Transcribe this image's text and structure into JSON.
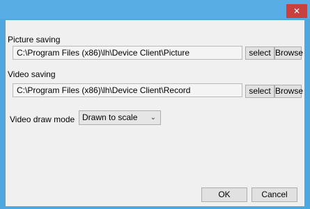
{
  "window": {
    "close_glyph": "✕"
  },
  "picture": {
    "label": "Picture saving",
    "path": "C:\\Program Files (x86)\\lh\\Device Client\\Picture",
    "select_label": "select",
    "browse_label": "Browse"
  },
  "video": {
    "label": "Video saving",
    "path": "C:\\Program Files (x86)\\lh\\Device Client\\Record",
    "select_label": "select",
    "browse_label": "Browse"
  },
  "draw_mode": {
    "label": "Video draw mode",
    "selected": "Drawn to scale"
  },
  "footer": {
    "ok_label": "OK",
    "cancel_label": "Cancel"
  },
  "colors": {
    "titlebar": "#58aee4",
    "close_button": "#c9413f",
    "client_background": "#f0f0f0"
  }
}
